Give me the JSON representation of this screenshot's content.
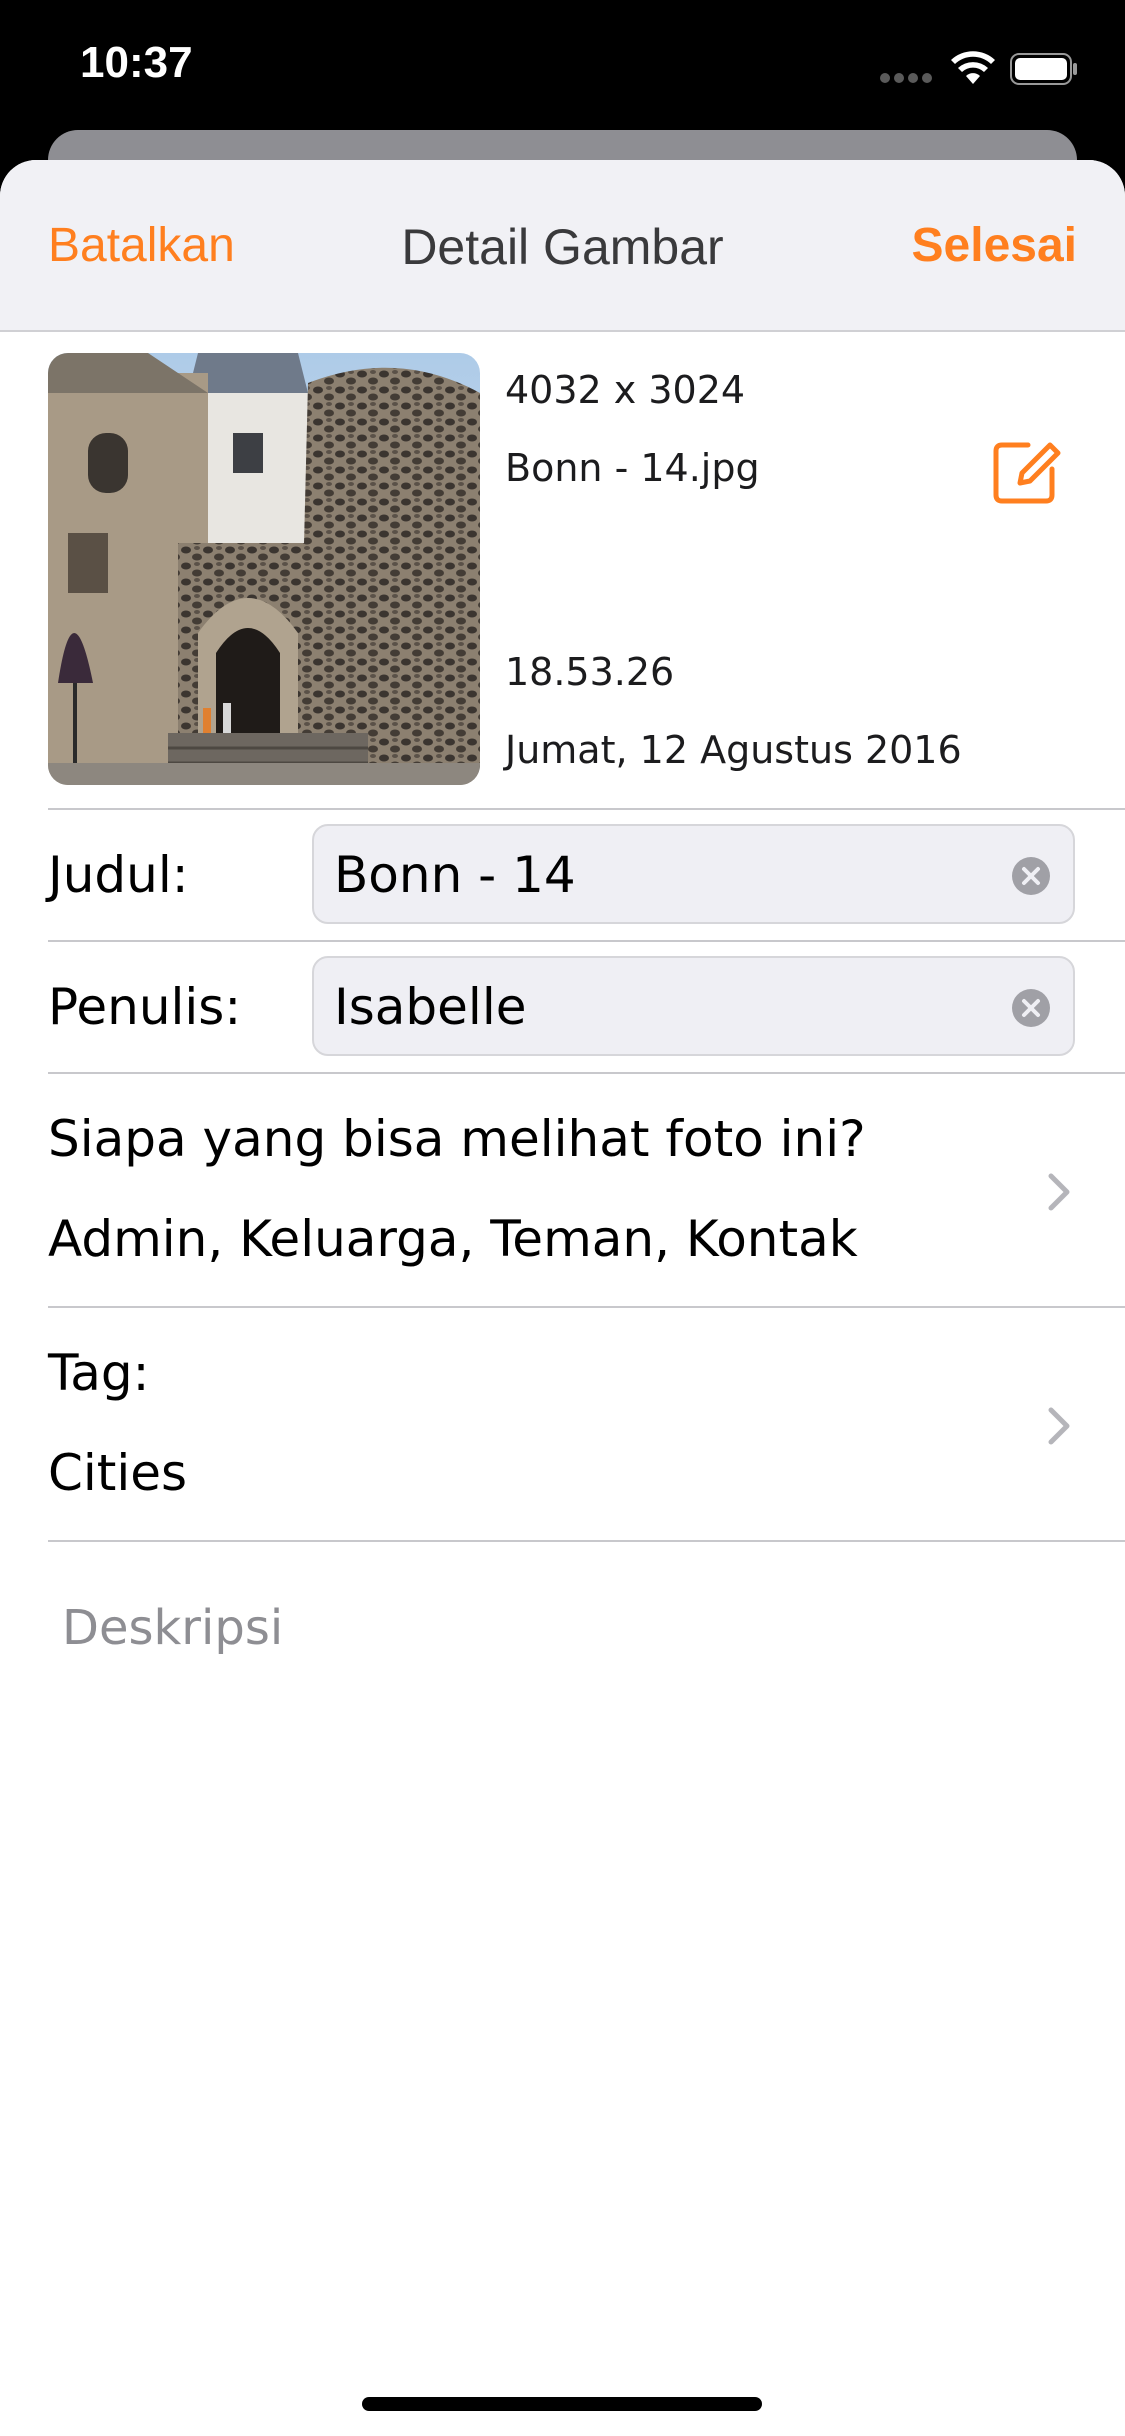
{
  "status_bar": {
    "time": "10:37"
  },
  "nav": {
    "cancel_label": "Batalkan",
    "title": "Detail Gambar",
    "done_label": "Selesai",
    "accent_color": "#ff7f1f"
  },
  "image_info": {
    "dimensions": "4032 x 3024",
    "filename": "Bonn - 14.jpg",
    "time": "18.53.26",
    "date": "Jumat, 12 Agustus 2016",
    "edit_icon": "square-pencil-icon"
  },
  "fields": {
    "title_label": "Judul:",
    "title_value": "Bonn - 14",
    "author_label": "Penulis:",
    "author_value": "Isabelle"
  },
  "privacy": {
    "question": "Siapa yang bisa melihat foto ini?",
    "value": "Admin, Keluarga, Teman, Kontak"
  },
  "tags": {
    "label": "Tag:",
    "value": "Cities"
  },
  "description": {
    "placeholder": "Deskripsi"
  }
}
